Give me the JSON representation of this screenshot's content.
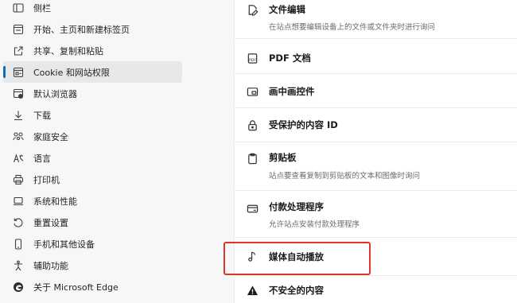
{
  "sidebar": {
    "items": [
      {
        "label": "侧栏",
        "icon": "sidebar-icon"
      },
      {
        "label": "开始、主页和新建标签页",
        "icon": "home-icon"
      },
      {
        "label": "共享、复制和粘贴",
        "icon": "share-icon"
      },
      {
        "label": "Cookie 和网站权限",
        "icon": "cookie-permissions-icon",
        "active": true
      },
      {
        "label": "默认浏览器",
        "icon": "default-browser-icon"
      },
      {
        "label": "下载",
        "icon": "download-icon"
      },
      {
        "label": "家庭安全",
        "icon": "family-icon"
      },
      {
        "label": "语言",
        "icon": "language-icon"
      },
      {
        "label": "打印机",
        "icon": "printer-icon"
      },
      {
        "label": "系统和性能",
        "icon": "system-icon"
      },
      {
        "label": "重置设置",
        "icon": "reset-icon"
      },
      {
        "label": "手机和其他设备",
        "icon": "phone-icon"
      },
      {
        "label": "辅助功能",
        "icon": "accessibility-icon"
      },
      {
        "label": "关于 Microsoft Edge",
        "icon": "edge-logo-icon"
      }
    ]
  },
  "permissions": {
    "file_editing": {
      "title": "文件编辑",
      "desc": "在站点想要编辑设备上的文件或文件夹时进行询问",
      "icon": "file-edit-icon"
    },
    "pdf": {
      "title": "PDF 文档",
      "icon": "pdf-icon"
    },
    "pip": {
      "title": "画中画控件",
      "icon": "picture-in-picture-icon"
    },
    "protected": {
      "title": "受保护的内容 ID",
      "icon": "lock-icon"
    },
    "clipboard": {
      "title": "剪贴板",
      "desc": "站点要查看复制到剪贴板的文本和图像时询问",
      "icon": "clipboard-icon"
    },
    "payment": {
      "title": "付款处理程序",
      "desc": "允许站点安装付款处理程序",
      "icon": "payment-icon"
    },
    "autoplay": {
      "title": "媒体自动播放",
      "icon": "music-note-icon"
    },
    "insecure": {
      "title": "不安全的内容",
      "icon": "warning-icon"
    }
  },
  "colors": {
    "highlight": "#e0342c",
    "accent": "#0f6cbd"
  }
}
